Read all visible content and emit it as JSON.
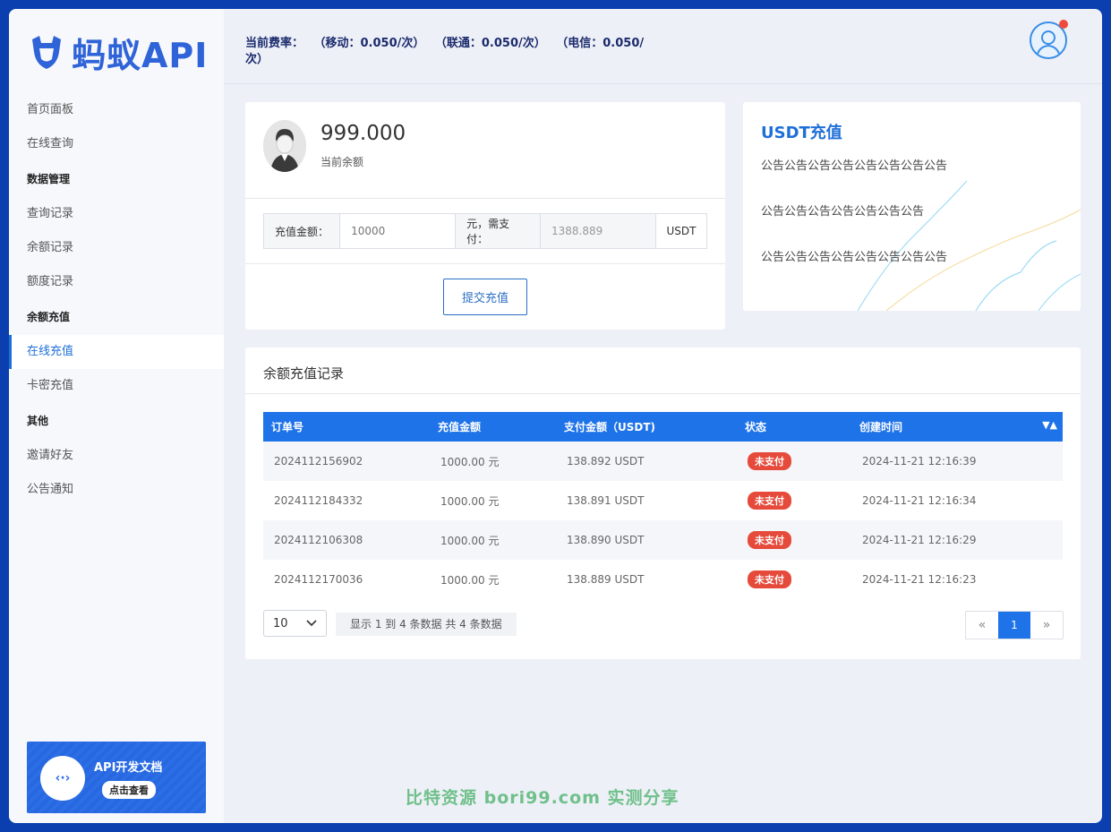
{
  "brand": {
    "name": "蚂蚁API",
    "color": "#2f63d8"
  },
  "header": {
    "rates_label": "当前费率：",
    "rate_mobile": "（移动：0.050/次）",
    "rate_unicom": "（联通：0.050/次）",
    "rate_telecom": "（电信：0.050/次）"
  },
  "sidebar": {
    "items": [
      {
        "label": "首页面板",
        "type": "item"
      },
      {
        "label": "在线查询",
        "type": "item"
      },
      {
        "label": "数据管理",
        "type": "group"
      },
      {
        "label": "查询记录",
        "type": "item"
      },
      {
        "label": "余额记录",
        "type": "item"
      },
      {
        "label": "额度记录",
        "type": "item"
      },
      {
        "label": "余额充值",
        "type": "group"
      },
      {
        "label": "在线充值",
        "type": "item",
        "active": true
      },
      {
        "label": "卡密充值",
        "type": "item"
      },
      {
        "label": "其他",
        "type": "group"
      },
      {
        "label": "邀请好友",
        "type": "item"
      },
      {
        "label": "公告通知",
        "type": "item"
      }
    ],
    "doc_card": {
      "icon": "code-arrows-icon",
      "title": "API开发文档",
      "button": "点击查看"
    }
  },
  "balance": {
    "value": "999.000",
    "label": "当前余额",
    "amount_label": "充值金额：",
    "amount_placeholder": "10000",
    "pay_label": "元，需支付：",
    "pay_value": "1388.889",
    "unit": "USDT",
    "submit": "提交充值"
  },
  "notice": {
    "title": "USDT充值",
    "lines": [
      "公告公告公告公告公告公告公告公告",
      "公告公告公告公告公告公告公告",
      "公告公告公告公告公告公告公告公告"
    ]
  },
  "records": {
    "title": "余额充值记录",
    "columns": [
      "订单号",
      "充值金额",
      "支付金额（USDT)",
      "状态",
      "创建时间"
    ],
    "rows": [
      {
        "order": "2024112156902",
        "amount": "1000.00 元",
        "usdt": "138.892 USDT",
        "status": "未支付",
        "time": "2024-11-21 12:16:39"
      },
      {
        "order": "2024112184332",
        "amount": "1000.00 元",
        "usdt": "138.891 USDT",
        "status": "未支付",
        "time": "2024-11-21 12:16:34"
      },
      {
        "order": "2024112106308",
        "amount": "1000.00 元",
        "usdt": "138.890 USDT",
        "status": "未支付",
        "time": "2024-11-21 12:16:29"
      },
      {
        "order": "2024112170036",
        "amount": "1000.00 元",
        "usdt": "138.889 USDT",
        "status": "未支付",
        "time": "2024-11-21 12:16:23"
      }
    ],
    "page_size": "10",
    "page_info": "显示 1 到 4 条数据 共 4 条数据",
    "pager": {
      "prev": "«",
      "current": "1",
      "next": "»"
    }
  },
  "watermark": "比特资源  bori99.com  实测分享",
  "colors": {
    "accent": "#1e73e8",
    "status_unpaid": "#e64a3b",
    "frame": "#0b3fb0"
  }
}
